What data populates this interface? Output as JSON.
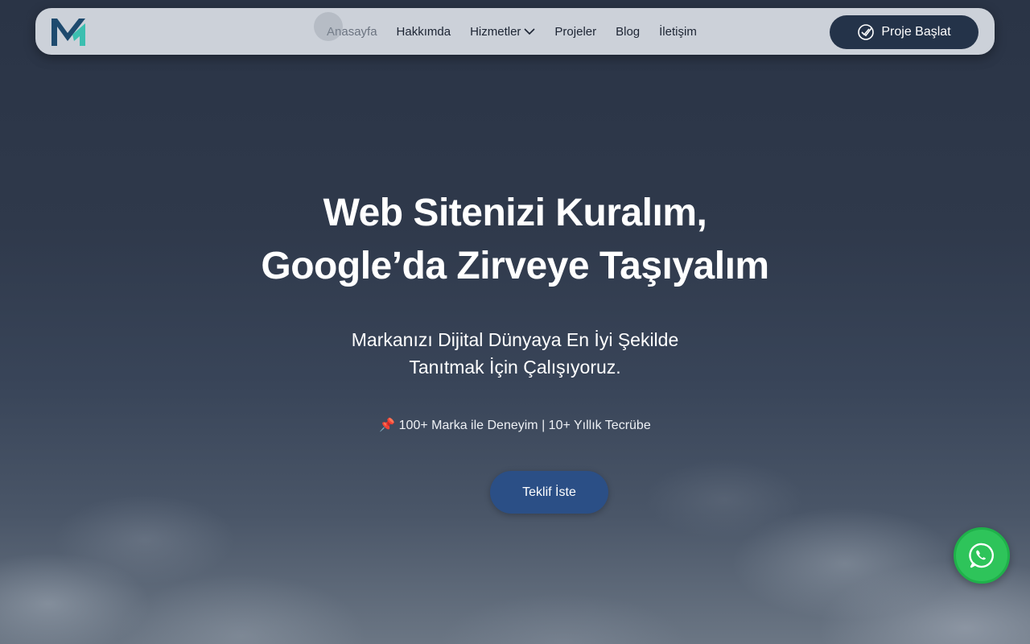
{
  "nav": {
    "logo_icon": "m-brand-logo",
    "items": [
      {
        "label": "Anasayfa",
        "active": true
      },
      {
        "label": "Hakkımda"
      },
      {
        "label": "Hizmetler",
        "has_dropdown": true
      },
      {
        "label": "Projeler"
      },
      {
        "label": "Blog"
      },
      {
        "label": "İletişim"
      }
    ],
    "cta_label": "Proje Başlat",
    "cta_icon": "double-check-icon"
  },
  "hero": {
    "title_line1": "Web Sitenizi Kuralım,",
    "title_line2": "Google’da Zirveye Taşıyalım",
    "subtitle_line1": "Markanızı Dijital Dünyaya En İyi Şekilde",
    "subtitle_line2": "Tanıtmak İçin Çalışıyoruz.",
    "note": "📌 100+ Marka ile Deneyim | 10+ Yıllık Tecrübe",
    "button_label": "Teklif İste"
  },
  "whatsapp": {
    "icon": "whatsapp-icon"
  },
  "colors": {
    "navy": "#243349",
    "accent_blue": "#2b4f86",
    "whatsapp_green": "#2ec45a",
    "logo_teal": "#3bbfb0"
  }
}
